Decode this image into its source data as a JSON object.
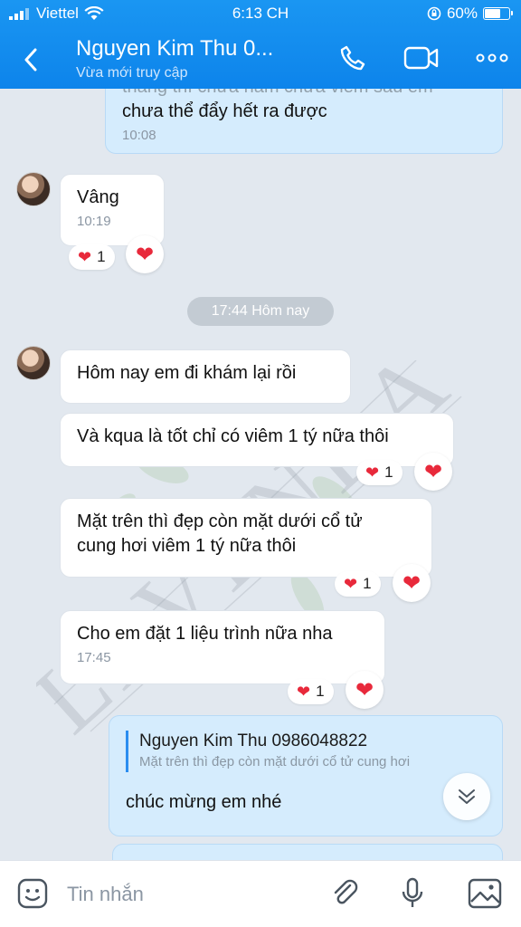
{
  "status_bar": {
    "carrier": "Viettel",
    "time": "6:13 CH",
    "battery": "60%",
    "battery_level": 0.6
  },
  "header": {
    "title": "Nguyen Kim Thu 0...",
    "subtitle": "Vừa mới truy cập"
  },
  "messages": [
    {
      "text": "chưa thể đẩy hết ra được",
      "partial_text": "tháng thì chưa nấm chưa viêm sâu em",
      "time": "10:08"
    },
    {
      "text": "Vâng",
      "time": "10:19",
      "reaction_count": "1"
    },
    {
      "text": "Hôm nay em đi khám lại rồi"
    },
    {
      "text": "Và kqua là tốt chỉ có viêm 1 tý nữa thôi",
      "reaction_count": "1"
    },
    {
      "line1": "Mặt trên thì đẹp còn mặt dưới cổ tử",
      "line2": "cung hơi viêm 1 tý nữa thôi",
      "reaction_count": "1"
    },
    {
      "text": "Cho em đặt 1 liệu trình nữa nha",
      "time": "17:45",
      "reaction_count": "1"
    },
    {
      "quote_name": "Nguyen Kim Thu 0986048822",
      "quote_text": "Mặt trên thì đẹp còn mặt dưới cổ tử cung hơi",
      "text": "chúc mừng em nhé"
    }
  ],
  "date_separator": "17:44 Hôm nay",
  "watermark": "LAVENDA",
  "input": {
    "placeholder": "Tin nhắn"
  },
  "colors": {
    "header": "#0d84eb",
    "my_bubble": "#d5ecfd",
    "heart": "#e8293b"
  }
}
